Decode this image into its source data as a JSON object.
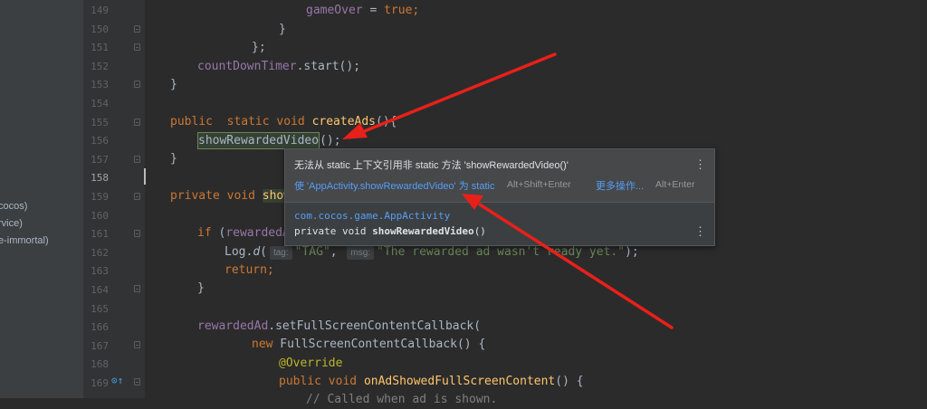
{
  "project_panel": {
    "items": [
      "cocos)",
      "rvice)",
      "e-immortal)"
    ]
  },
  "gutter": {
    "line_numbers": [
      "149",
      "150",
      "151",
      "152",
      "153",
      "154",
      "155",
      "156",
      "157",
      "158",
      "159",
      "160",
      "161",
      "162",
      "163",
      "164",
      "165",
      "166",
      "167",
      "168",
      "169"
    ],
    "current_line": "158",
    "override_icon": "override-method-icon"
  },
  "code": {
    "l149": {
      "a": "gameOver",
      "b": " = ",
      "c": "true",
      "d": ";"
    },
    "l150": {
      "a": "}"
    },
    "l151": {
      "a": "};"
    },
    "l152": {
      "a": "countDownTimer",
      "b": ".start();"
    },
    "l153": {
      "a": "}"
    },
    "l155": {
      "a": "public",
      "b": "  ",
      "c": "static",
      "d": " ",
      "e": "void",
      "f": " ",
      "g": "createAds",
      "h": "(){"
    },
    "l156": {
      "a": "showRewardedVideo",
      "b": "();"
    },
    "l157": {
      "a": "}"
    },
    "l159": {
      "a": "private",
      "b": " ",
      "c": "void",
      "d": " ",
      "e": "show"
    },
    "l161": {
      "a": "if",
      "b": " (",
      "c": "rewardedA"
    },
    "l162": {
      "a": "Log.",
      "b": "d",
      "c": "(",
      "hint1": "tag:",
      "d": "\"TAG\"",
      "e": ", ",
      "hint2": "msg:",
      "f": "\"The rewarded ad wasn't ready yet.\"",
      "g": ");"
    },
    "l163": {
      "a": "return",
      "b": ";"
    },
    "l164": {
      "a": "}"
    },
    "l166": {
      "a": "rewardedAd",
      "b": ".setFullScreenContentCallback("
    },
    "l167": {
      "a": "new",
      "b": " FullScreenContentCallback() {"
    },
    "l168": {
      "a": "@Override"
    },
    "l169": {
      "a": "public",
      "b": " ",
      "c": "void",
      "d": " ",
      "e": "onAdShowedFullScreenContent",
      "f": "() {"
    },
    "l170": {
      "a": "// Called when ad is shown."
    }
  },
  "popup": {
    "message": "无法从 static 上下文引用非 static 方法 'showRewardedVideo()'",
    "fix_label": "使 'AppActivity.showRewardedVideo' 为 static",
    "fix_shortcut": "Alt+Shift+Enter",
    "more_label": "更多操作...",
    "more_shortcut": "Alt+Enter",
    "kebab": "⋮",
    "class_ref": "com.cocos.game.AppActivity",
    "sig_prefix": "private void ",
    "sig_name": "showRewardedVideo",
    "sig_suffix": "()"
  },
  "annotations": {
    "arrow_color": "#e8201a"
  },
  "colors": {
    "editor_bg": "#2b2b2b",
    "keyword": "#cc7832",
    "method": "#ffc66d",
    "field": "#9876aa",
    "string": "#6a8759",
    "link": "#589df6"
  }
}
